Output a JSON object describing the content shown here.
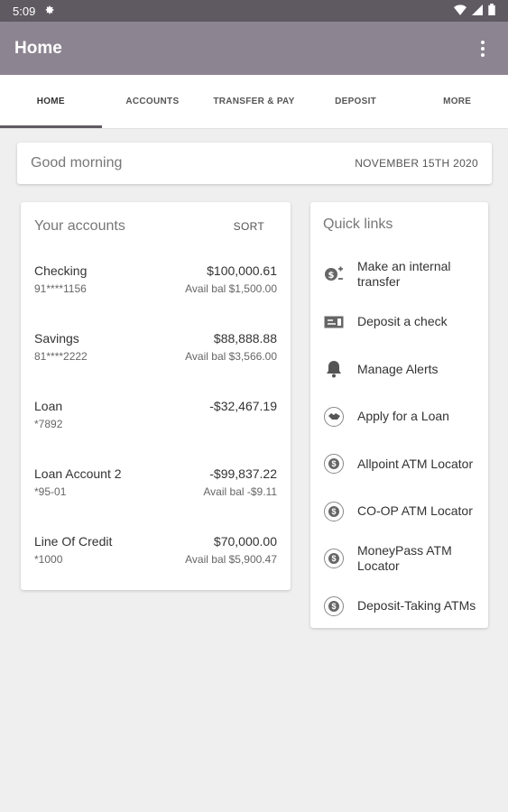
{
  "status": {
    "time": "5:09"
  },
  "app": {
    "title": "Home"
  },
  "tabs": [
    {
      "label": "HOME"
    },
    {
      "label": "ACCOUNTS"
    },
    {
      "label": "TRANSFER & PAY"
    },
    {
      "label": "DEPOSIT"
    },
    {
      "label": "MORE"
    }
  ],
  "greeting": {
    "text": "Good morning",
    "date": "NOVEMBER 15TH 2020"
  },
  "accounts": {
    "title": "Your accounts",
    "sort_label": "SORT",
    "items": [
      {
        "name": "Checking",
        "number": "91****1156",
        "amount": "$100,000.61",
        "avail": "Avail bal $1,500.00"
      },
      {
        "name": "Savings",
        "number": "81****2222",
        "amount": "$88,888.88",
        "avail": "Avail bal $3,566.00"
      },
      {
        "name": "Loan",
        "number": "*7892",
        "amount": "-$32,467.19",
        "avail": ""
      },
      {
        "name": "Loan Account 2",
        "number": "*95-01",
        "amount": "-$99,837.22",
        "avail": "Avail bal -$9.11"
      },
      {
        "name": "Line Of Credit",
        "number": "*1000",
        "amount": "$70,000.00",
        "avail": "Avail bal $5,900.47"
      }
    ]
  },
  "quick_links": {
    "title": "Quick links",
    "items": [
      {
        "label": "Make an internal transfer",
        "icon": "transfer-icon"
      },
      {
        "label": "Deposit a check",
        "icon": "check-icon"
      },
      {
        "label": "Manage Alerts",
        "icon": "bell-icon"
      },
      {
        "label": "Apply for a Loan",
        "icon": "handshake-icon"
      },
      {
        "label": "Allpoint ATM Locator",
        "icon": "atm-icon"
      },
      {
        "label": "CO-OP ATM Locator",
        "icon": "atm-icon"
      },
      {
        "label": "MoneyPass ATM Locator",
        "icon": "atm-icon"
      },
      {
        "label": "Deposit-Taking ATMs",
        "icon": "atm-icon"
      }
    ]
  },
  "colors": {
    "status_bar": "#5f5a62",
    "app_bar": "#8c8490",
    "background": "#efefef"
  }
}
